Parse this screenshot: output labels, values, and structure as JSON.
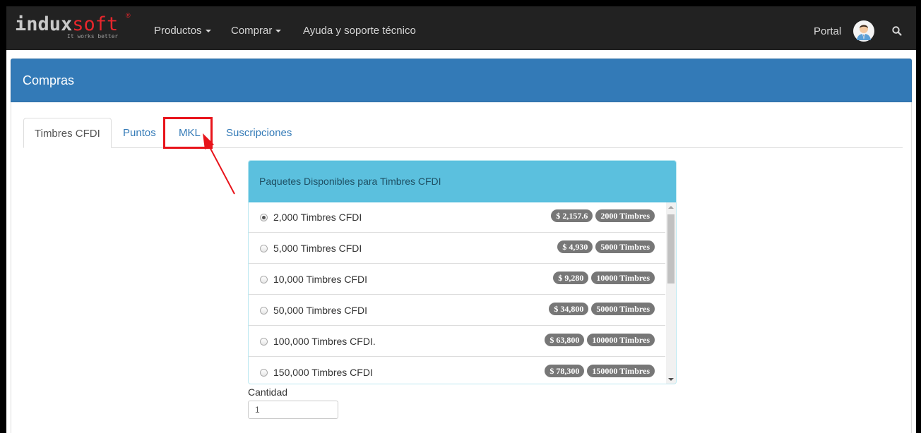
{
  "navbar": {
    "brand_part1": "indux",
    "brand_part2": "soft",
    "brand_registered": "®",
    "brand_tagline": "It works better",
    "items": [
      {
        "label": "Productos",
        "dropdown": true
      },
      {
        "label": "Comprar",
        "dropdown": true
      },
      {
        "label": "Ayuda y soporte técnico",
        "dropdown": false
      }
    ],
    "portal_label": "Portal",
    "avatar_icon": "user-avatar-icon",
    "search_icon": "search-icon"
  },
  "panel": {
    "title": "Compras"
  },
  "tabs": [
    {
      "label": "Timbres CFDI",
      "active": true
    },
    {
      "label": "Puntos",
      "active": false
    },
    {
      "label": "MKL",
      "active": false,
      "highlighted": true
    },
    {
      "label": "Suscripciones",
      "active": false
    }
  ],
  "packages": {
    "title": "Paquetes Disponibles para Timbres CFDI",
    "items": [
      {
        "label": "2,000 Timbres CFDI",
        "price": "$ 2,157.6",
        "timbres": "2000 Timbres",
        "selected": true
      },
      {
        "label": "5,000 Timbres CFDI",
        "price": "$ 4,930",
        "timbres": "5000 Timbres",
        "selected": false
      },
      {
        "label": "10,000 Timbres CFDI",
        "price": "$ 9,280",
        "timbres": "10000 Timbres",
        "selected": false
      },
      {
        "label": "50,000 Timbres CFDI",
        "price": "$ 34,800",
        "timbres": "50000 Timbres",
        "selected": false
      },
      {
        "label": "100,000 Timbres CFDI.",
        "price": "$ 63,800",
        "timbres": "100000 Timbres",
        "selected": false
      },
      {
        "label": "150,000 Timbres CFDI",
        "price": "$ 78,300",
        "timbres": "150000 Timbres",
        "selected": false
      }
    ]
  },
  "quantity": {
    "label": "Cantidad",
    "value": "1"
  },
  "colors": {
    "navbar": "#222222",
    "panel_primary": "#337ab7",
    "panel_info": "#5bc0de",
    "annotation": "#e8141b",
    "badge": "#777777"
  }
}
